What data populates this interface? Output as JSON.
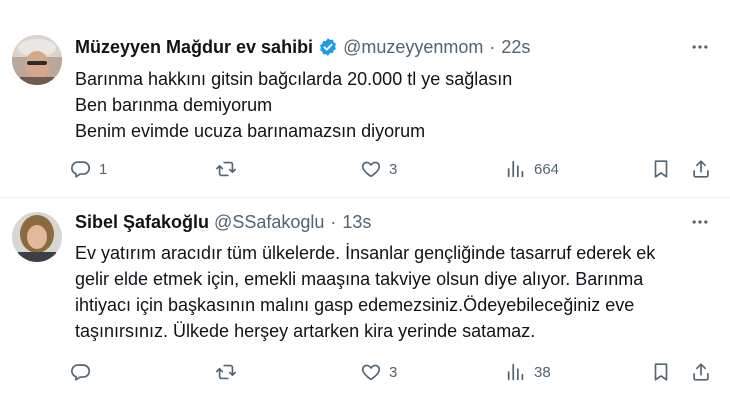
{
  "tweets": [
    {
      "display_name": "Müzeyyen Mağdur ev sahibi",
      "verified": true,
      "handle": "@muzeyyenmom",
      "separator": "·",
      "time": "22s",
      "lines": [
        "Barınma hakkını gitsin bağcılarda 20.000 tl ye sağlasın",
        "Ben barınma demiyorum",
        "Benim evimde ucuza barınamazsın diyorum"
      ],
      "reply_count": "1",
      "retweet_count": "",
      "like_count": "3",
      "view_count": "664"
    },
    {
      "display_name": "Sibel Şafakoğlu",
      "verified": false,
      "handle": "@SSafakoglu",
      "separator": "·",
      "time": "13s",
      "lines": [
        "Ev yatırım aracıdır tüm ülkelerde. İnsanlar gençliğinde tasarruf ederek ek",
        "gelir elde etmek için, emekli maaşına takviye olsun diye alıyor. Barınma",
        "ihtiyacı için başkasının malını gasp edemezsiniz.Ödeyebileceğiniz eve",
        "taşınırsınız. Ülkede herşey artarken kira yerinde satamaz."
      ],
      "reply_count": "",
      "retweet_count": "",
      "like_count": "3",
      "view_count": "38"
    }
  ],
  "icons": {
    "verified": "verified-badge-icon",
    "more": "more-icon",
    "reply": "reply-icon",
    "retweet": "retweet-icon",
    "like": "like-icon",
    "views": "views-icon",
    "bookmark": "bookmark-icon",
    "share": "share-icon"
  },
  "colors": {
    "text": "#0f1419",
    "secondary": "#536471",
    "verified": "#1d9bf0",
    "divider": "#eff3f4"
  }
}
